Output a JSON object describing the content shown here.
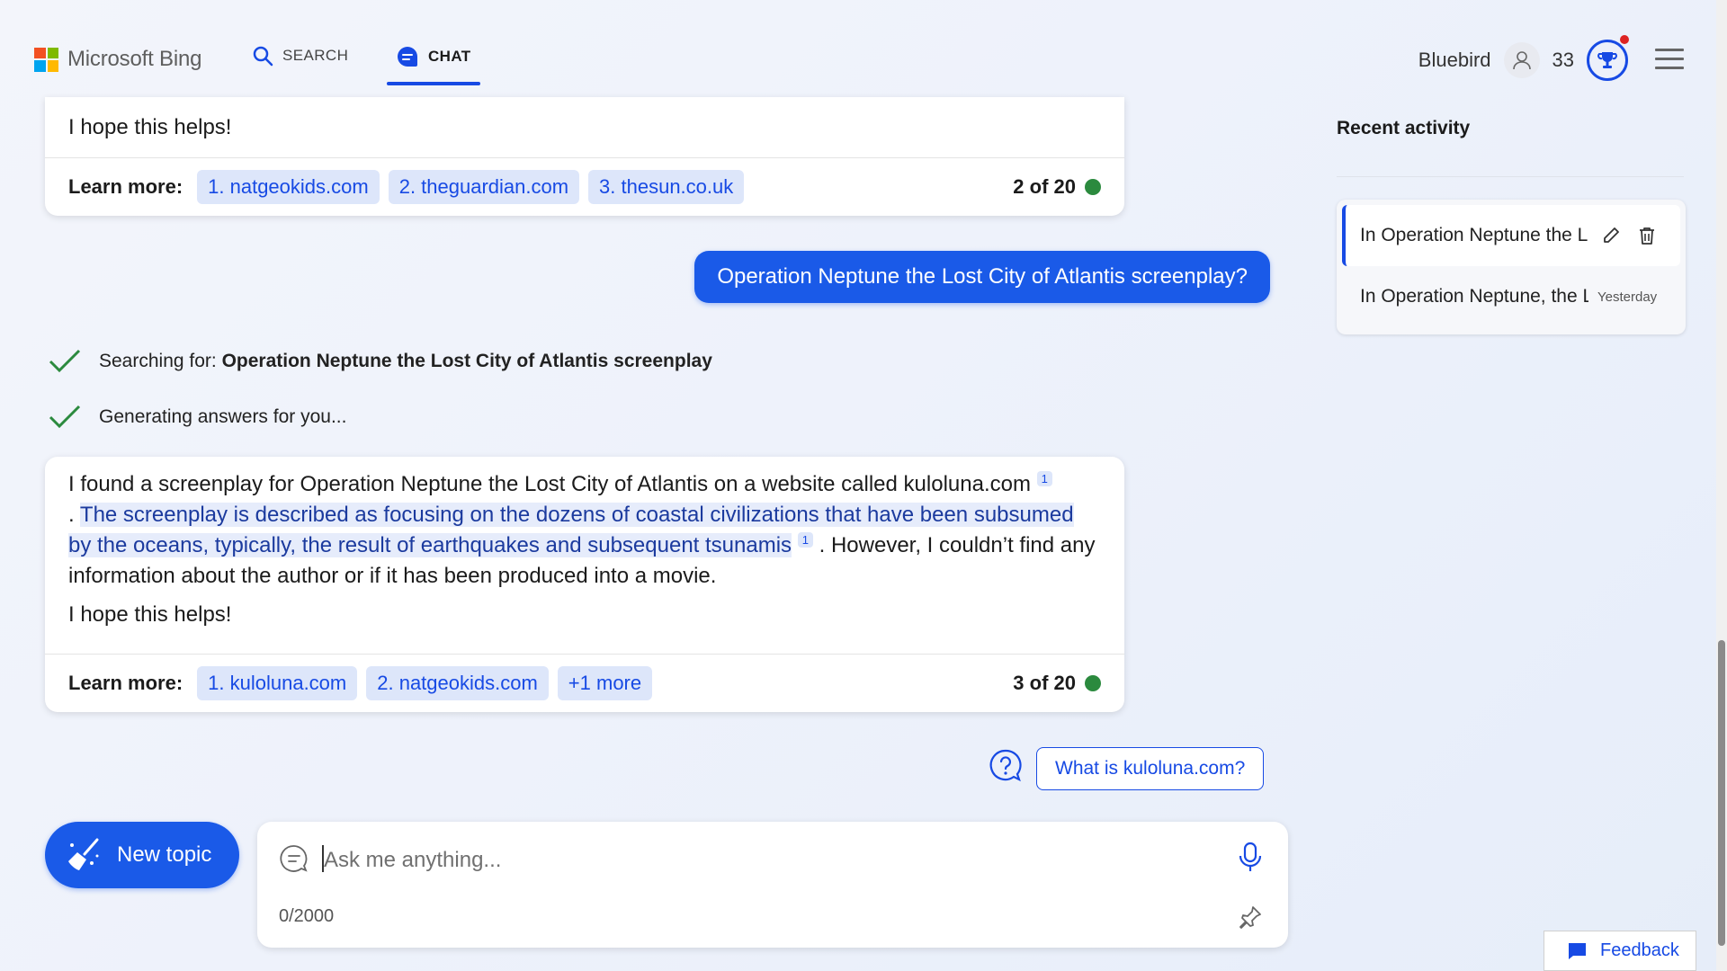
{
  "header": {
    "logo_text": "Microsoft Bing",
    "nav": [
      {
        "label": "SEARCH",
        "icon": "search-icon"
      },
      {
        "label": "CHAT",
        "icon": "chat-bubble-icon",
        "active": true
      }
    ],
    "user_name": "Bluebird",
    "points": "33",
    "colors": {
      "accent": "#174ae4",
      "logo": [
        "#f25022",
        "#7fba00",
        "#00a4ef",
        "#ffb900"
      ]
    }
  },
  "conversation": {
    "previous_response": {
      "closing": "I hope this helps!",
      "learn_more_label": "Learn more:",
      "links": [
        "1. natgeokids.com",
        "2. theguardian.com",
        "3. thesun.co.uk"
      ],
      "count": "2 of 20"
    },
    "user_message": "Operation Neptune the Lost City of Atlantis screenplay?",
    "status": {
      "searching_prefix": "Searching for: ",
      "searching_query": "Operation Neptune the Lost City of Atlantis screenplay",
      "generating": "Generating answers for you..."
    },
    "response": {
      "part1": "I found a screenplay for Operation Neptune the Lost City of Atlantis on a website called kuloluna.com",
      "cite1": "1",
      "part2_prefix": ". ",
      "highlighted": "The screenplay is described as focusing on the dozens of coastal civilizations that have been subsumed by the oceans, typically, the result of earthquakes and subsequent tsunamis",
      "cite2": "1",
      "part3": ". However, I couldn’t find any information about the author or if it has been produced into a movie.",
      "closing": "I hope this helps!",
      "learn_more_label": "Learn more:",
      "links": [
        "1. kuloluna.com",
        "2. natgeokids.com",
        "+1 more"
      ],
      "count": "3 of 20"
    },
    "suggestion": "What is kuloluna.com?"
  },
  "composer": {
    "new_topic_label": "New topic",
    "placeholder": "Ask me anything...",
    "char_counter": "0/2000"
  },
  "recent_activity": {
    "title": "Recent activity",
    "items": [
      {
        "text": "In Operation Neptune the Lost City of Atlantis"
      },
      {
        "text": "In Operation Neptune, the Lost City of Atlantis",
        "date": "Yesterday"
      }
    ]
  },
  "feedback_label": "Feedback"
}
